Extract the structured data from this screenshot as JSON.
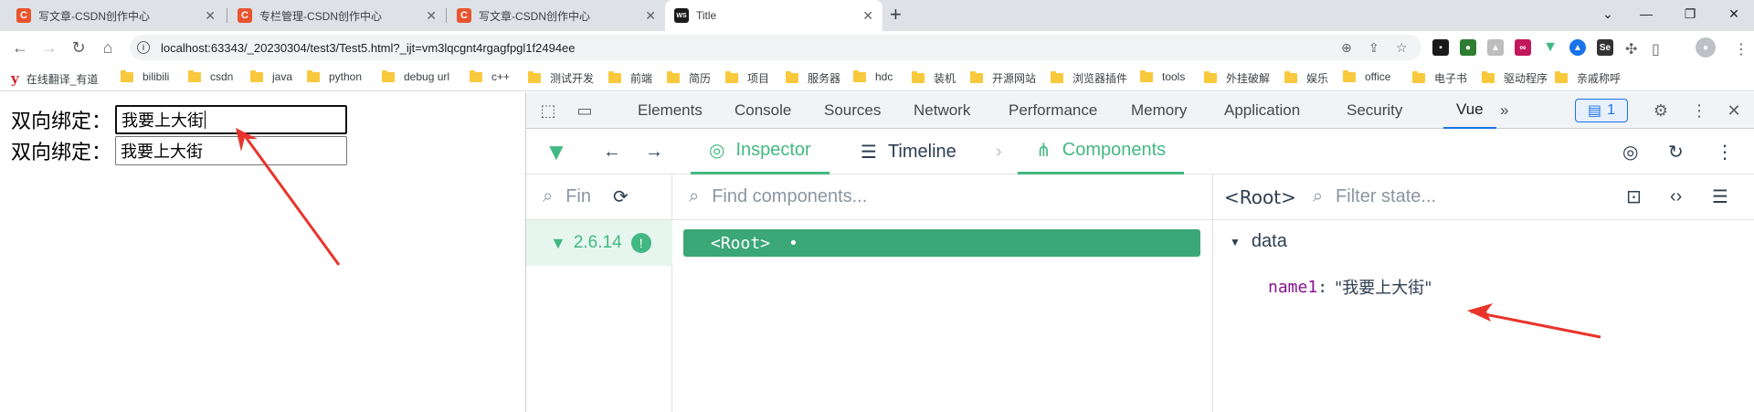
{
  "tabs": [
    {
      "title": "写文章-CSDN创作中心",
      "icon": "C"
    },
    {
      "title": "专栏管理-CSDN创作中心",
      "icon": "C"
    },
    {
      "title": "写文章-CSDN创作中心",
      "icon": "C"
    },
    {
      "title": "Title",
      "icon": "WS"
    }
  ],
  "address": {
    "url": "localhost:63343/_20230304/test3/Test5.html?_ijt=vm3lqcgnt4rgagfpgl1f2494ee"
  },
  "bookmarks": [
    "在线翻译_有道",
    "bilibili",
    "csdn",
    "java",
    "python",
    "debug url",
    "c++",
    "测试开发",
    "前端",
    "简历",
    "项目",
    "服务器",
    "hdc",
    "装机",
    "开源网站",
    "浏览器插件",
    "tools",
    "外挂破解",
    "娱乐",
    "office",
    "电子书",
    "驱动程序",
    "亲戚称呼"
  ],
  "page": {
    "row1_label": "双向绑定：",
    "row1_value": "我要上大街",
    "row2_label": "双向绑定：",
    "row2_value": "我要上大街"
  },
  "devtools": {
    "tabs": [
      "Elements",
      "Console",
      "Sources",
      "Network",
      "Performance",
      "Memory",
      "Application",
      "Security",
      "Vue"
    ],
    "more": "»",
    "issues_count": "1"
  },
  "vue": {
    "tabs": [
      "Inspector",
      "Timeline",
      "Components"
    ],
    "search_apps_placeholder": "Fin",
    "find_components_placeholder": "Find components...",
    "app_version": "2.6.14",
    "root_node": "<Root>",
    "root_dot": "•",
    "selected_label": "<Root>",
    "filter_state_placeholder": "Filter state...",
    "state_section": "data",
    "state_key": "name1",
    "state_value": "\"我要上大街\""
  },
  "colors": {
    "vue_green": "#42b883",
    "root_bg": "#3ba776",
    "chrome_blue": "#1a73e8",
    "arrow_red": "#e8342b"
  }
}
